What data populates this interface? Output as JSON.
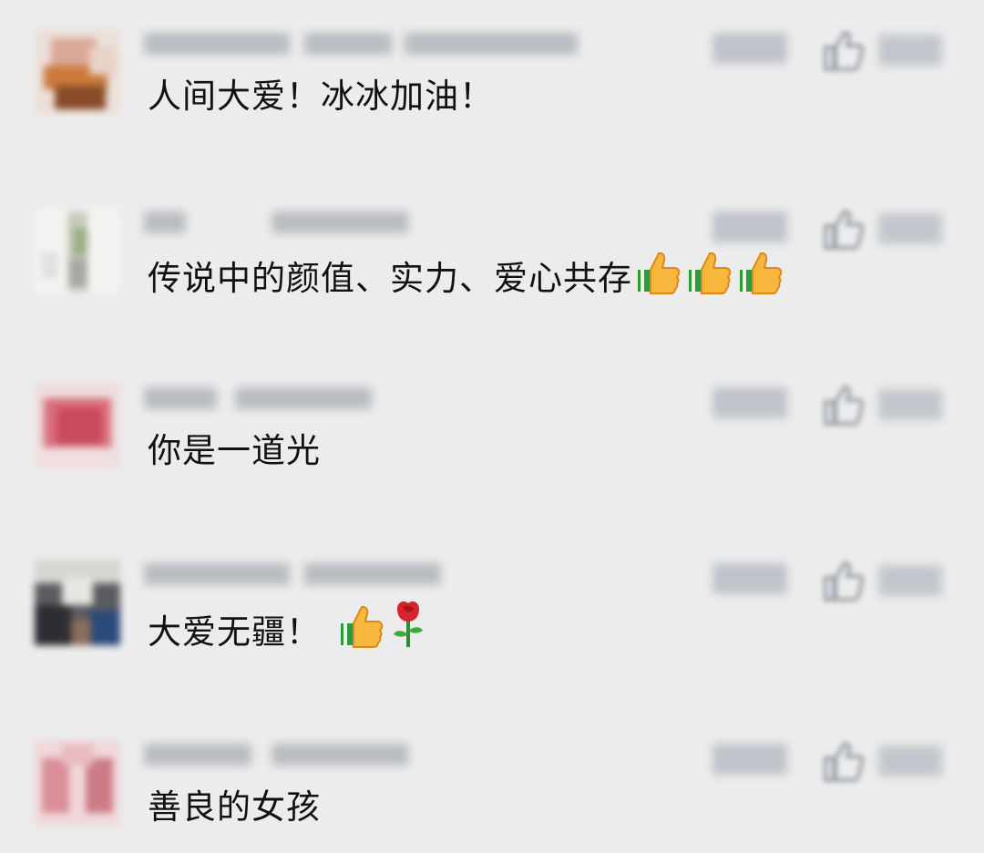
{
  "comments": [
    {
      "text": "人间大爱！冰冰加油！",
      "emojis": [],
      "avatar_colors": [
        "#e8d8d2",
        "#d99a7a",
        "#c8722f",
        "#7a4a2c",
        "#f0e6e0"
      ]
    },
    {
      "text": "传说中的颜值、实力、爱心共存",
      "emojis": [
        "thumbs-up-icon",
        "thumbs-up-icon",
        "thumbs-up-icon"
      ],
      "avatar_colors": [
        "#f2f2f0",
        "#b8c0a8",
        "#8a9a7a",
        "#d8d8d4",
        "#e6e6e4"
      ]
    },
    {
      "text": "你是一道光",
      "emojis": [],
      "avatar_colors": [
        "#e9d3d6",
        "#d98890",
        "#c74e5c",
        "#e2a8ae",
        "#f0e4e4"
      ]
    },
    {
      "text": "大爱无疆！",
      "emojis": [
        "thumbs-up-icon",
        "rose-icon"
      ],
      "avatar_colors": [
        "#3a3c42",
        "#6b6e70",
        "#d2d4d0",
        "#2a4a78",
        "#8a7060"
      ]
    },
    {
      "text": "善良的女孩",
      "emojis": [],
      "avatar_colors": [
        "#ecc8cc",
        "#d99aa2",
        "#c77880",
        "#e6b6bc",
        "#f2dcde"
      ]
    }
  ],
  "colors": {
    "background": "#ececec",
    "text": "#111111",
    "blur_gray": "#b9bcc2"
  }
}
